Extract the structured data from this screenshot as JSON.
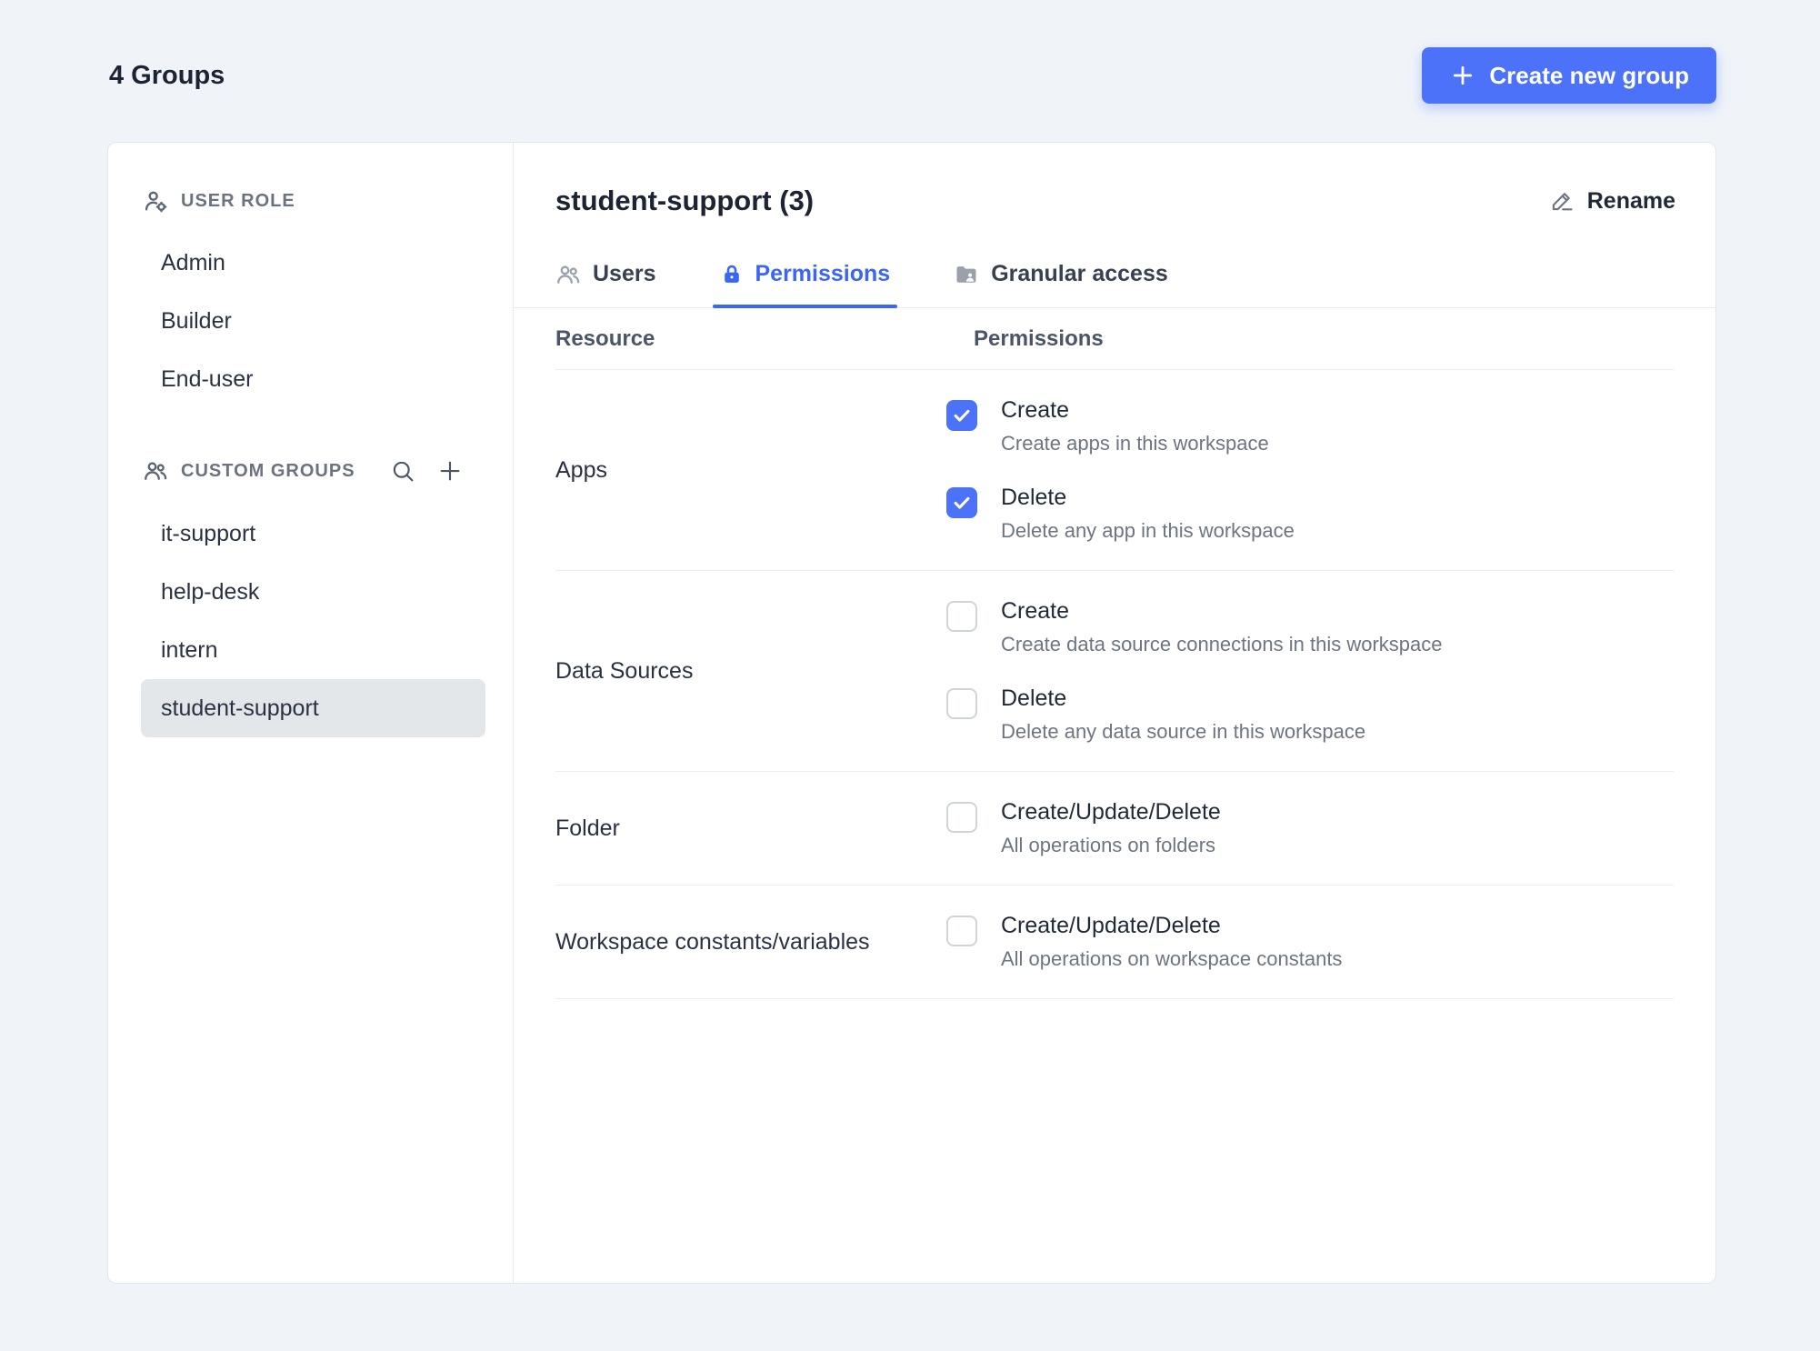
{
  "colors": {
    "accent": "#4d72fa",
    "background": "#f0f4f9",
    "selected_item_bg": "#e4e7ea"
  },
  "page": {
    "title": "4 Groups",
    "create_button_label": "Create new group"
  },
  "sidebar": {
    "user_role": {
      "header": "USER ROLE",
      "items": [
        "Admin",
        "Builder",
        "End-user"
      ]
    },
    "custom_groups": {
      "header": "CUSTOM GROUPS",
      "items": [
        "it-support",
        "help-desk",
        "intern",
        "student-support"
      ],
      "selected": "student-support"
    }
  },
  "main": {
    "title": "student-support (3)",
    "rename_label": "Rename",
    "active_tab": "Permissions",
    "tabs": [
      {
        "label": "Users"
      },
      {
        "label": "Permissions"
      },
      {
        "label": "Granular access"
      }
    ],
    "table": {
      "headers": {
        "resource": "Resource",
        "permissions": "Permissions"
      },
      "rows": [
        {
          "resource": "Apps",
          "permissions": [
            {
              "label": "Create",
              "description": "Create apps in this workspace",
              "checked": true
            },
            {
              "label": "Delete",
              "description": "Delete any app in this workspace",
              "checked": true
            }
          ]
        },
        {
          "resource": "Data Sources",
          "permissions": [
            {
              "label": "Create",
              "description": "Create data source connections in this workspace",
              "checked": false
            },
            {
              "label": "Delete",
              "description": "Delete any data source in this workspace",
              "checked": false
            }
          ]
        },
        {
          "resource": "Folder",
          "permissions": [
            {
              "label": "Create/Update/Delete",
              "description": "All operations on folders",
              "checked": false
            }
          ]
        },
        {
          "resource": "Workspace constants/variables",
          "permissions": [
            {
              "label": "Create/Update/Delete",
              "description": "All operations on workspace constants",
              "checked": false
            }
          ]
        }
      ]
    }
  },
  "icons": {
    "plus": "plus",
    "user_role": "person-with-gear",
    "custom_groups": "people",
    "search": "magnifier",
    "add_group": "plus",
    "users_tab": "people",
    "permissions_tab": "lock",
    "granular_access_tab": "folder",
    "rename": "pencil",
    "checkbox_checked": "checkmark"
  }
}
